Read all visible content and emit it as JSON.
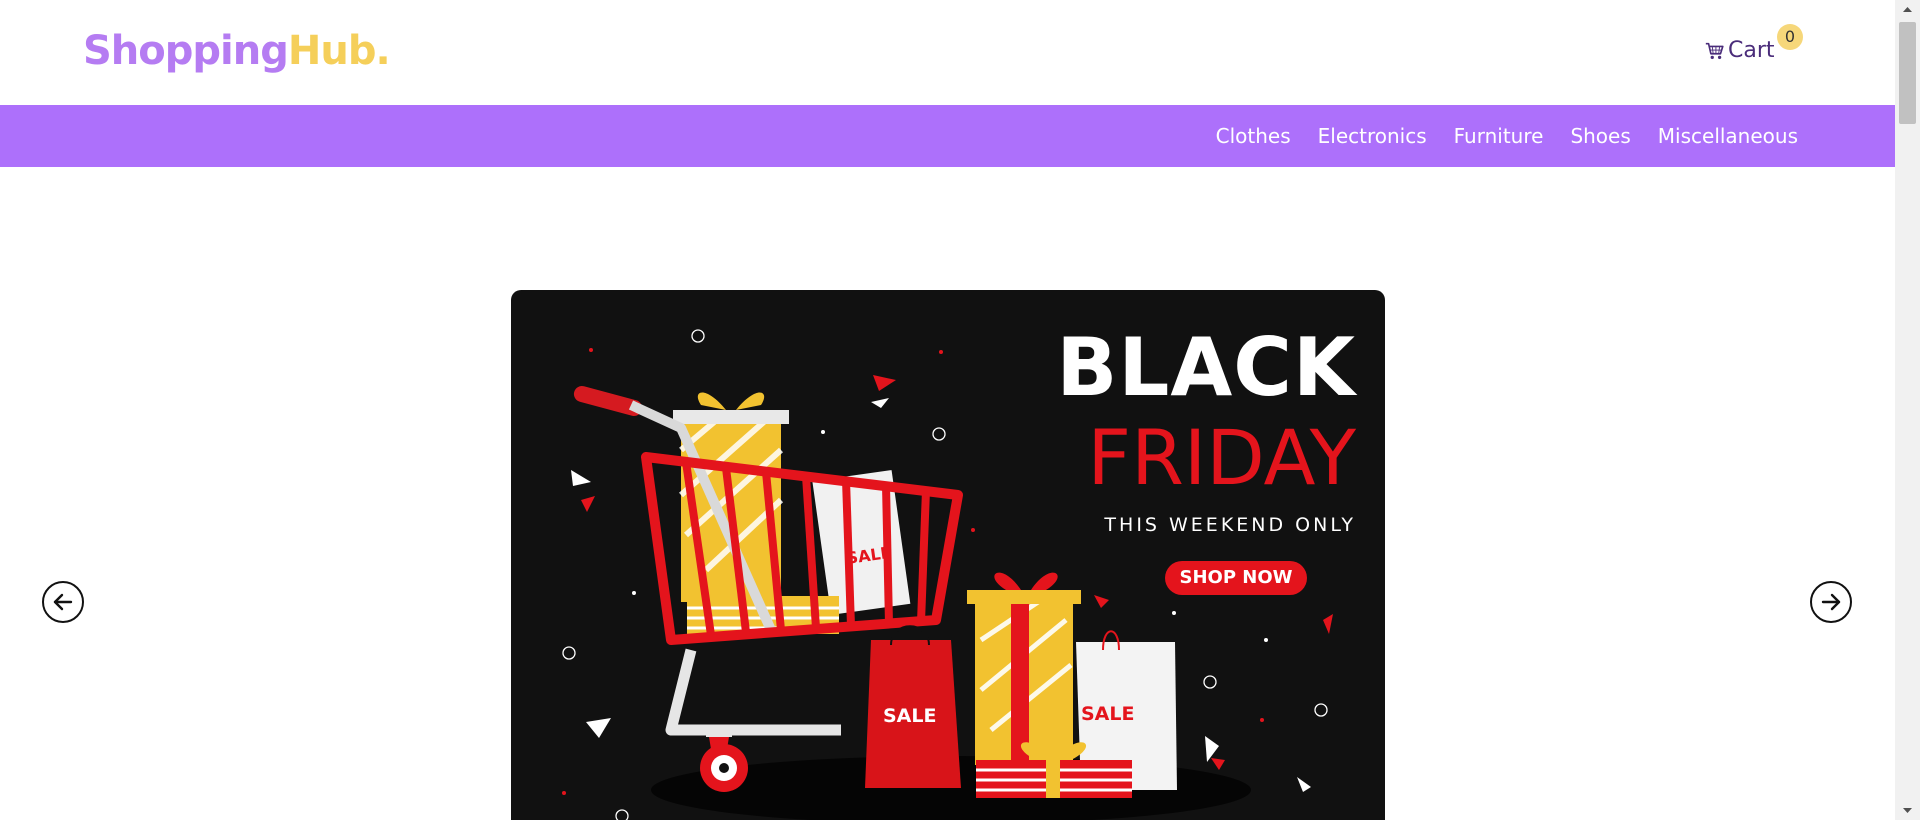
{
  "header": {
    "logo_part1": "Shopping",
    "logo_part2": "Hub.",
    "cart_label": "Cart",
    "cart_count": "0",
    "cart_icon": "shopping-cart-icon"
  },
  "nav": {
    "items": [
      {
        "label": "Clothes"
      },
      {
        "label": "Electronics"
      },
      {
        "label": "Furniture"
      },
      {
        "label": "Shoes"
      },
      {
        "label": "Miscellaneous"
      }
    ]
  },
  "slider": {
    "prev_icon": "arrow-left-circle-icon",
    "next_icon": "arrow-right-circle-icon",
    "banner": {
      "title_line1": "BLACK",
      "title_line2": "FRIDAY",
      "subtitle": "THIS WEEKEND ONLY",
      "cta": "SHOP NOW",
      "sale_tag_1": "SALE",
      "sale_tag_2": "SALE",
      "sale_tag_3": "SALE"
    }
  },
  "colors": {
    "brand_purple": "#ad70fb",
    "logo_purple": "#b57cf2",
    "logo_yellow": "#f5cf5a",
    "banner_bg": "#111111",
    "accent_red": "#e4141c",
    "gift_yellow": "#f2c230"
  }
}
